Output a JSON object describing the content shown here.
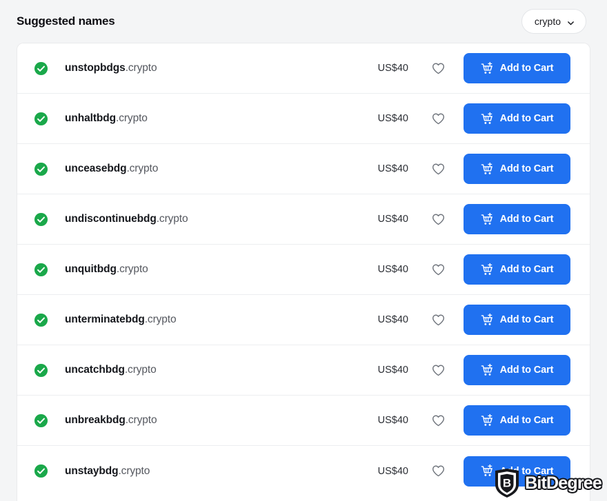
{
  "header": {
    "title": "Suggested names",
    "filter": {
      "label": "crypto",
      "chevron_icon": "chevron-down-icon"
    }
  },
  "colors": {
    "page_background": "#f4f5f6",
    "card_background": "#ffffff",
    "accent_button": "#2071f0",
    "available_check": "#1aa84a",
    "divider": "#eceef0",
    "price_text": "#2b2e34"
  },
  "list": {
    "row_icons": {
      "status_icon": "check-circle-icon",
      "favorite_icon": "heart-outline-icon",
      "cart_icon": "cart-plus-icon"
    },
    "cart_label": "Add to Cart",
    "items": [
      {
        "sld": "unstopbdgs",
        "tld": ".crypto",
        "price": "US$40"
      },
      {
        "sld": "unhaltbdg",
        "tld": ".crypto",
        "price": "US$40"
      },
      {
        "sld": "unceasebdg",
        "tld": ".crypto",
        "price": "US$40"
      },
      {
        "sld": "undiscontinuebdg",
        "tld": ".crypto",
        "price": "US$40"
      },
      {
        "sld": "unquitbdg",
        "tld": ".crypto",
        "price": "US$40"
      },
      {
        "sld": "unterminatebdg",
        "tld": ".crypto",
        "price": "US$40"
      },
      {
        "sld": "uncatchbdg",
        "tld": ".crypto",
        "price": "US$40"
      },
      {
        "sld": "unbreakbdg",
        "tld": ".crypto",
        "price": "US$40"
      },
      {
        "sld": "unstaybdg",
        "tld": ".crypto",
        "price": "US$40"
      }
    ]
  },
  "watermark": {
    "text": "BitDegree",
    "logo_letter": "B",
    "logo_icon": "bitdegree-shield-icon"
  }
}
